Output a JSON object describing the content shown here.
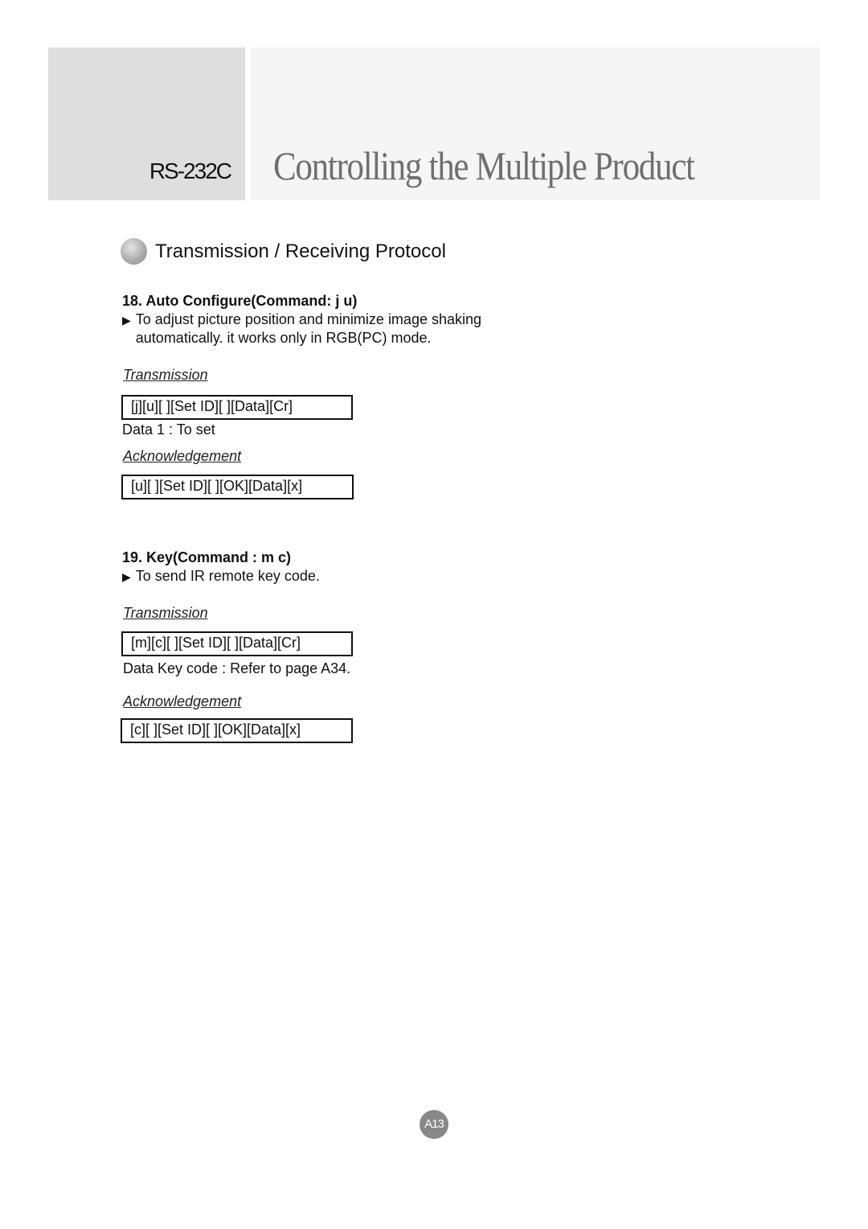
{
  "header": {
    "subtitle": "RS-232C",
    "title": "Controlling the Multiple Product"
  },
  "section": {
    "icon": "gray-ball-icon",
    "title": "Transmission / Receiving Protocol"
  },
  "commands": [
    {
      "heading": "18. Auto Configure(Command: j u)",
      "description_lines": [
        "To adjust picture position and minimize image shaking",
        "automatically. it works only in RGB(PC) mode."
      ],
      "transmission_label": "Transmission",
      "transmission": "[j][u][ ][Set ID][ ][Data][Cr]",
      "data_note": "Data 1 : To set",
      "ack_label": "Acknowledgement",
      "ack": "[u][ ][Set ID][ ][OK][Data][x]"
    },
    {
      "heading": "19. Key(Command : m c)",
      "description_lines": [
        "To send IR remote key code."
      ],
      "transmission_label": "Transmission",
      "transmission": "[m][c][ ][Set ID][ ][Data][Cr]",
      "data_note": "Data  Key code : Refer to page A34.",
      "ack_label": "Acknowledgement",
      "ack": "[c][ ][Set ID][ ][OK][Data][x]"
    }
  ],
  "bullet_glyph": "▶",
  "page_number": "A13"
}
